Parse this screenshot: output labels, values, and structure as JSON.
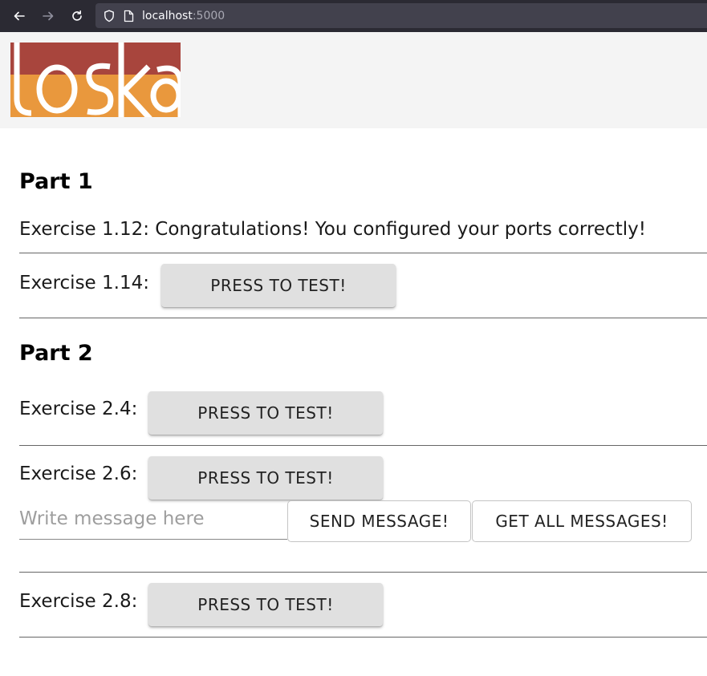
{
  "browser": {
    "url_host": "localhost",
    "url_port": ":5000"
  },
  "header": {
    "logo_name": "toska"
  },
  "part1": {
    "title": "Part 1",
    "ex112_label": "Exercise 1.12: Congratulations! You configured your ports correctly!",
    "ex114_label": "Exercise 1.14:",
    "ex114_button": "PRESS TO TEST!"
  },
  "part2": {
    "title": "Part 2",
    "ex24_label": "Exercise 2.4:",
    "ex24_button": "PRESS TO TEST!",
    "ex26_label": "Exercise 2.6:",
    "ex26_button": "PRESS TO TEST!",
    "message_placeholder": "Write message here",
    "message_value": "",
    "send_button": "SEND MESSAGE!",
    "get_all_button": "GET ALL MESSAGES!",
    "ex28_label": "Exercise 2.8:",
    "ex28_button": "PRESS TO TEST!"
  },
  "colors": {
    "logo_red": "#a8453d",
    "logo_orange": "#e9983d",
    "button_gray": "#e0e0e0",
    "header_bg": "#f4f4f4"
  }
}
